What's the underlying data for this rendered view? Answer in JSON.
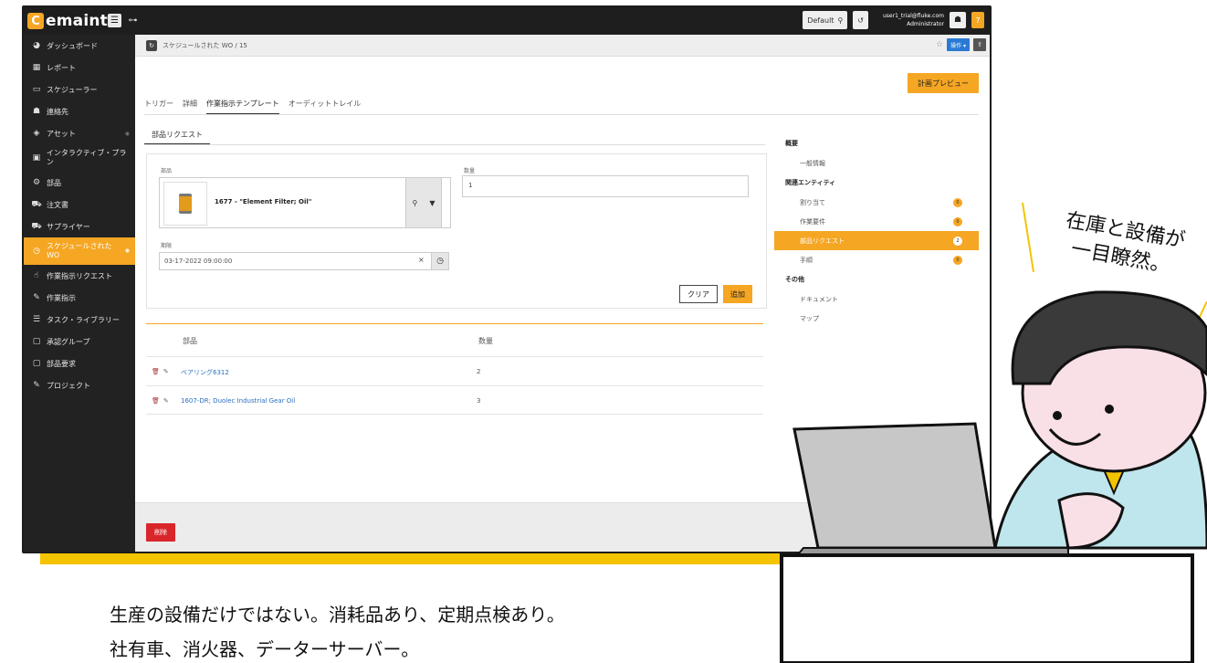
{
  "colors": {
    "accent": "#f5a623",
    "frame": "#f5c400",
    "danger": "#d9262a",
    "link": "#2a6fbd"
  },
  "app": {
    "logo_mark": "C",
    "logo_text": "emaint"
  },
  "topbar": {
    "default_label": "Default",
    "user_email": "user1_trial@fluke.com",
    "user_role": "Administrator",
    "badge": "7"
  },
  "sidebar": {
    "items": [
      {
        "icon": "dashboard-icon",
        "glyph": "◕",
        "label": "ダッシュボード"
      },
      {
        "icon": "table-icon",
        "glyph": "▦",
        "label": "レポート"
      },
      {
        "icon": "calendar-icon",
        "glyph": "▭",
        "label": "スケジューラー"
      },
      {
        "icon": "contacts-icon",
        "glyph": "☗",
        "label": "連絡先"
      },
      {
        "icon": "cube-icon",
        "glyph": "◈",
        "label": "アセット"
      },
      {
        "icon": "image-icon",
        "glyph": "▣",
        "label": "インタラクティブ・プラン"
      },
      {
        "icon": "cogs-icon",
        "glyph": "⚙",
        "label": "部品"
      },
      {
        "icon": "cart-icon",
        "glyph": "⛟",
        "label": "注文書"
      },
      {
        "icon": "truck-icon",
        "glyph": "⛟",
        "label": "サプライヤー"
      },
      {
        "icon": "clock-icon",
        "glyph": "◷",
        "label": "スケジュールされた WO"
      },
      {
        "icon": "hand-icon",
        "glyph": "☝",
        "label": "作業指示リクエスト"
      },
      {
        "icon": "wrench-icon",
        "glyph": "✎",
        "label": "作業指示"
      },
      {
        "icon": "list-icon",
        "glyph": "☰",
        "label": "タスク・ライブラリー"
      },
      {
        "icon": "file-icon",
        "glyph": "▢",
        "label": "承認グループ"
      },
      {
        "icon": "file-icon",
        "glyph": "▢",
        "label": "部品要求"
      },
      {
        "icon": "tag-icon",
        "glyph": "✎",
        "label": "プロジェクト"
      }
    ]
  },
  "breadcrumb": {
    "text": "スケジュールされた WO / 15",
    "operations": "操作 ▾"
  },
  "plan_preview": "計画プレビュー",
  "tabs": [
    "トリガー",
    "詳細",
    "作業指示テンプレート",
    "オーディットトレイル"
  ],
  "subtab": "部品リクエスト",
  "form": {
    "part_label": "部品",
    "part_name": "1677 - \"Element Filter; Oil\"",
    "qty_label": "数量",
    "qty_value": "1",
    "date_label": "期限",
    "date_value": "03-17-2022 09:00:00",
    "clear": "クリア",
    "add": "追加"
  },
  "table": {
    "headers": [
      "部品",
      "数量"
    ],
    "rows": [
      {
        "name": "ベアリング6312",
        "qty": "2"
      },
      {
        "name": "1607-DR; Duolec Industrial Gear Oil",
        "qty": "3"
      }
    ]
  },
  "right_panel": {
    "summary": "概要",
    "general": "一般情報",
    "related": "関連エンティティ",
    "assign": "割り当て",
    "assign_count": "0",
    "tasks": "作業要件",
    "tasks_count": "0",
    "parts": "部品リクエスト",
    "parts_count": "2",
    "steps": "手順",
    "steps_count": "0",
    "other": "その他",
    "documents": "ドキュメント",
    "map": "マップ"
  },
  "footer": {
    "delete": "削除"
  },
  "bubble": {
    "line1": "在庫と設備が",
    "line2": "一目瞭然。"
  },
  "caption": {
    "line1": "生産の設備だけではない。消耗品あり、定期点検あり。",
    "line2": "社有車、消火器、データーサーバー。"
  }
}
